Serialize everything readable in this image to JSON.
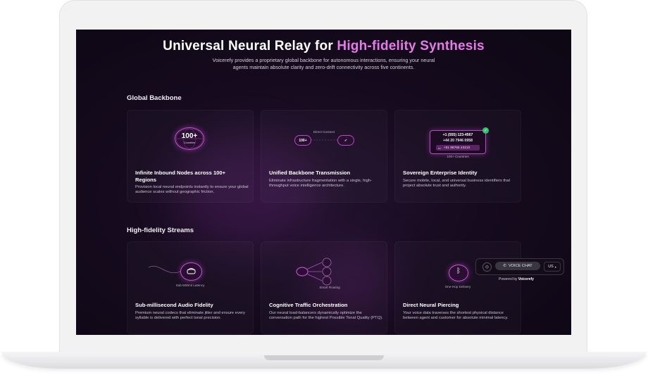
{
  "hero": {
    "title_main": "Universal Neural Relay for ",
    "title_accent": "High-fidelity Synthesis",
    "subtitle": "Voicerefy provides a proprietary global backbone for autonomous interactions, ensuring your neural agents maintain absolute clarity and zero-drift connectivity across five continents."
  },
  "sections": [
    {
      "title": "Global Backbone",
      "cards": [
        {
          "visual": {
            "badge": "100+",
            "badge_caption": "Countries"
          },
          "title": "Infinite Inbound Nodes across 100+ Regions",
          "desc": "Provision local neural endpoints instantly to ensure your global audience scales without geographic friction."
        },
        {
          "visual": {
            "caption": "Direct Connect",
            "left_pill": "100+",
            "right_icon": "check-icon"
          },
          "title": "Unified Backbone Transmission",
          "desc": "Eliminate infrastructure fragmentation with a single, high-throughput voice intelligence architecture."
        },
        {
          "visual": {
            "numbers": [
              "+1 (555) 123-4567",
              "+44 20 7946 0958",
              "+91 98765 43210"
            ],
            "caption": "100+ Countries",
            "flag_icon": "flag-icon"
          },
          "title": "Sovereign Enterprise Identity",
          "desc": "Secure mobile, local, and universal business identifiers that project absolute trust and authority."
        }
      ]
    },
    {
      "title": "High-fidelity Streams",
      "cards": [
        {
          "visual": {
            "caption": "Sub-500ms Latency",
            "icon": "headset-icon"
          },
          "title": "Sub-millisecond Audio Fidelity",
          "desc": "Premium neural codecs that eliminate jitter and ensure every syllable is delivered with perfect tonal precision."
        },
        {
          "visual": {
            "caption": "Smart Routing"
          },
          "title": "Cognitive Traffic Orchestration",
          "desc": "Our neural load-balancers dynamically optimize the conversation path for the highest Possible Tonal Quality (PTQ)."
        },
        {
          "visual": {
            "caption": "One-Hop Delivery",
            "icon": "bluetooth-icon"
          },
          "title": "Direct Neural Piercing",
          "desc": "Your voice data traverses the shortest physical distance between agent and customer for absolute minimal latency."
        }
      ]
    }
  ],
  "widget": {
    "voice_label": "VOICE CHAT",
    "lang": "US",
    "powered_prefix": "Powered by ",
    "powered_brand": "Voicerefy"
  },
  "colors": {
    "accent": "#e67ae8",
    "background": "#160b1f",
    "ring": "#c34fd0"
  }
}
